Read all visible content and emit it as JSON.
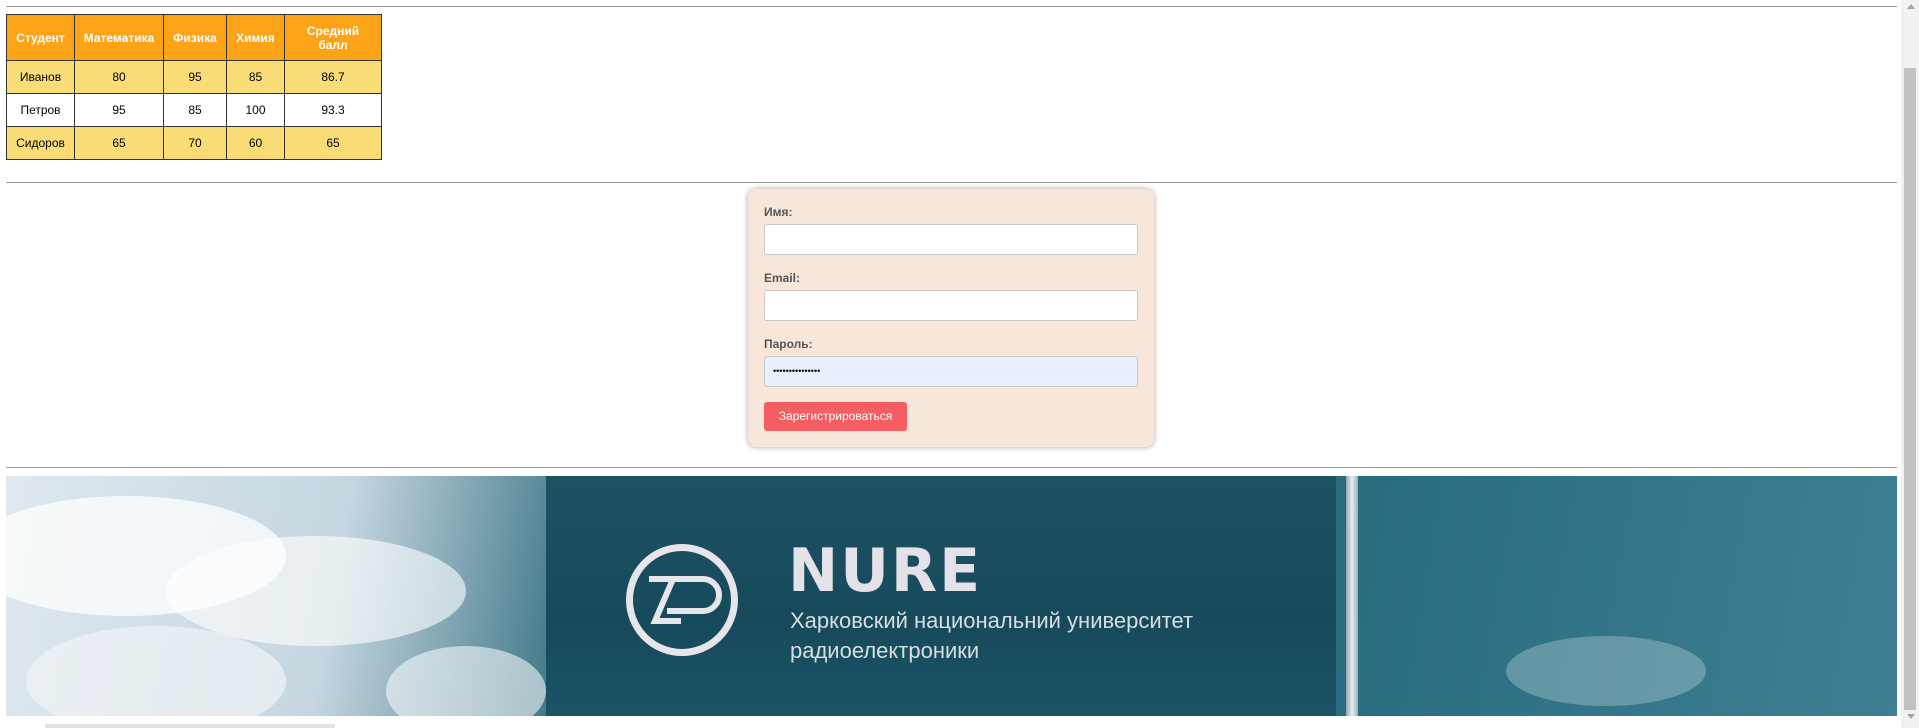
{
  "table": {
    "headers": [
      "Студент",
      "Математика",
      "Физика",
      "Химия",
      "Средний балл"
    ],
    "rows": [
      [
        "Иванов",
        "80",
        "95",
        "85",
        "86.7"
      ],
      [
        "Петров",
        "95",
        "85",
        "100",
        "93.3"
      ],
      [
        "Сидоров",
        "65",
        "70",
        "60",
        "65"
      ]
    ]
  },
  "form": {
    "name_label": "Имя:",
    "name_value": "",
    "email_label": "Email:",
    "email_value": "",
    "password_label": "Пароль:",
    "password_value": "•••••••••••••••",
    "submit_label": "Зарегистрироваться"
  },
  "banner": {
    "logo_text": "NURE",
    "subtitle_line1": "Харковский национальний университет",
    "subtitle_line2": "радиоелектроники"
  },
  "colors": {
    "header_bg": "#fda318",
    "odd_row_bg": "#f9dc76",
    "form_bg": "#f8e6da",
    "button_bg": "#f45d62"
  }
}
